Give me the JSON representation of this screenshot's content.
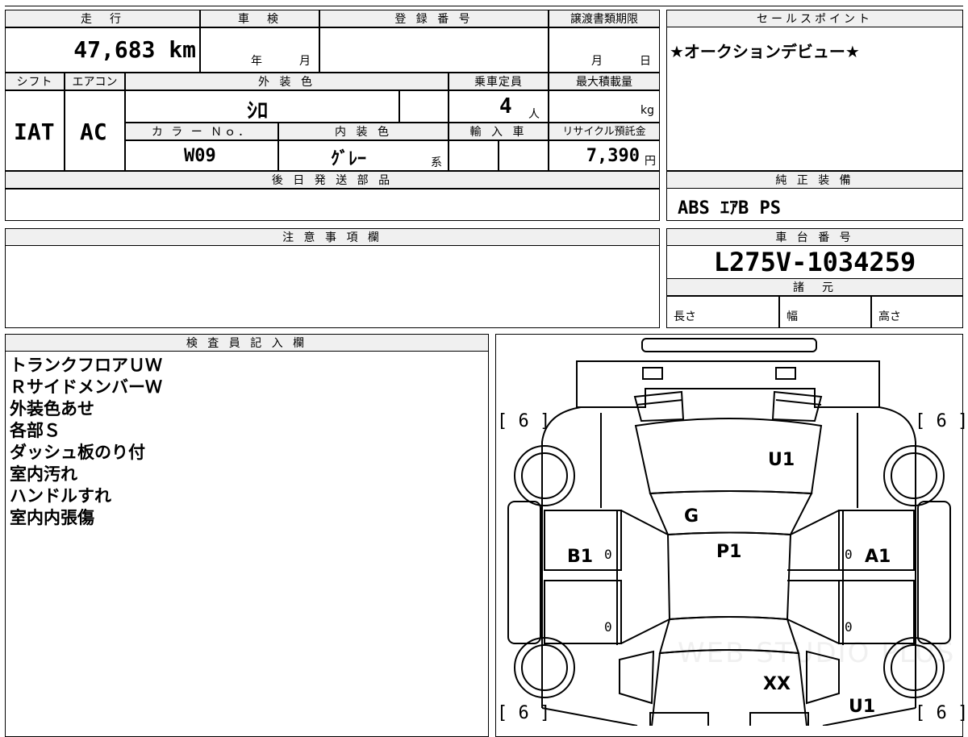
{
  "sheet": {
    "mileage_label": "走　行",
    "mileage": "47,683 km",
    "shaken_label": "車　検",
    "shaken_year_unit": "年",
    "shaken_month_unit": "月",
    "reg_label": "登 録 番 号",
    "doc_deadline_label": "譲渡書類期限",
    "doc_month_unit": "月",
    "doc_day_unit": "日",
    "sales_point_label": "セールスポイント",
    "sales_point": "★オークションデビュー★",
    "shift_label": "シフト",
    "aircon_label": "エアコン",
    "ext_color_label": "外 装 色",
    "capacity_label": "乗車定員",
    "max_load_label": "最大積載量",
    "shift_value": "IAT",
    "aircon_value": "AC",
    "ext_color_value": "ｼﾛ",
    "capacity_value": "4",
    "capacity_unit": "人",
    "max_load_unit": "kg",
    "color_no_label": "カ ラ ー Ｎｏ．",
    "int_color_label": "内 装 色",
    "import_label": "輸 入 車",
    "recycle_label": "リサイクル預託金",
    "color_no_value": "W09",
    "int_color_value": "ｸﾞﾚｰ",
    "int_color_suffix": "系",
    "recycle_value": "7,390",
    "recycle_unit": "円",
    "later_parts_label": "後 日 発 送 部 品",
    "genuine_label": "純 正 装 備",
    "genuine_value": "ABS ｴｱB PS",
    "notice_label": "注 意 事 項 欄",
    "chassis_label": "車 台 番 号",
    "chassis_value": "L275V-1034259",
    "spec_label": "諸　元",
    "length_label": "長さ",
    "width_label": "幅",
    "height_label": "高さ",
    "inspector_label": "検 査 員 記 入 欄",
    "inspector_notes": [
      "トランクフロアＵＷ",
      "ＲサイドメンバーＷ",
      "外装色あせ",
      "各部Ｓ",
      "ダッシュ板のり付",
      "室内汚れ",
      "ハンドルすれ",
      "室内内張傷"
    ]
  },
  "diagram": {
    "tire_left_top": "[ 6 ]",
    "tire_right_top": "[ 6 ]",
    "tire_left_bottom": "[ 6 ]",
    "tire_right_bottom": "[ 6 ]",
    "hood": "U1",
    "front_grille": "G",
    "roof": "P1",
    "left_front_door": "B1",
    "right_front_door": "A1",
    "left_front_door_zero": "0",
    "right_front_door_zero": "0",
    "left_rear_door_zero": "0",
    "right_rear_door_zero": "0",
    "rear_panel": "XX",
    "rear_quarter": "U1",
    "watermark": "WEB STUDIO PLUS"
  }
}
